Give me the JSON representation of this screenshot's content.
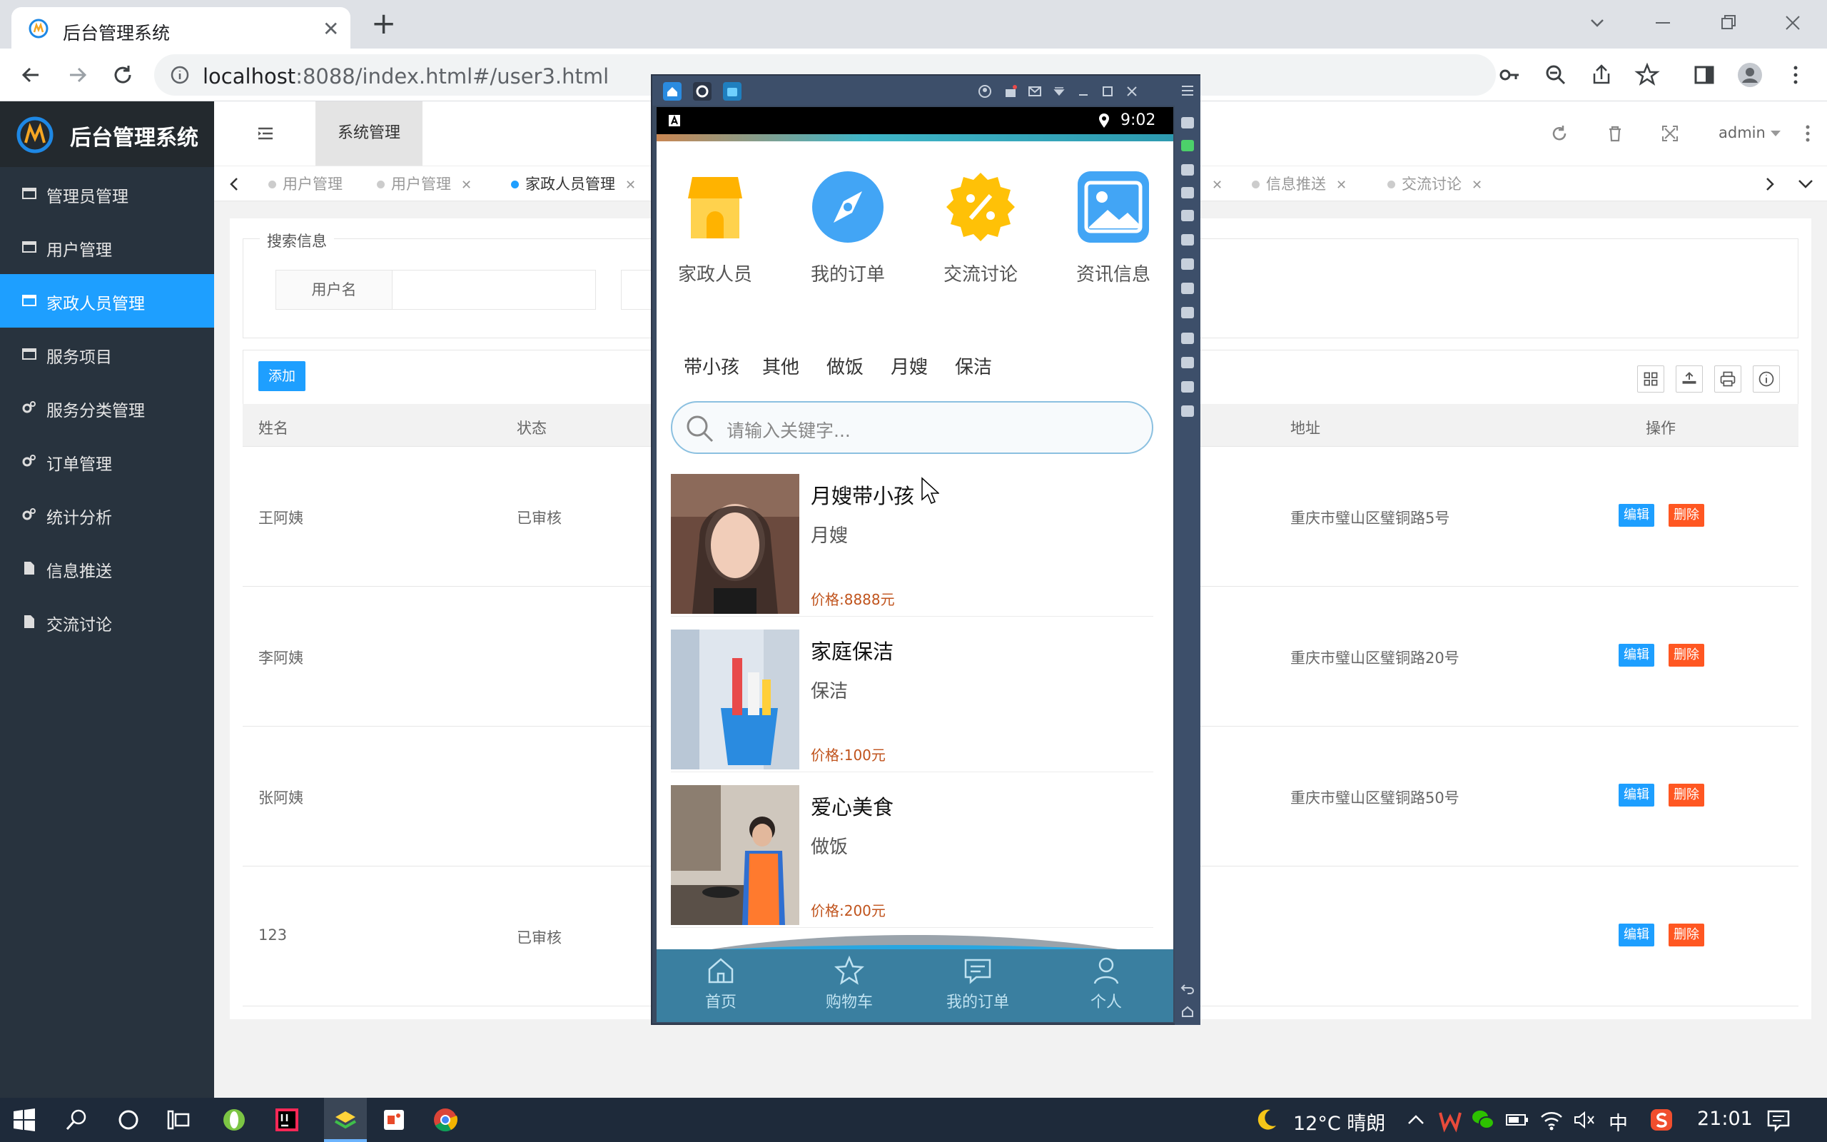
{
  "browser": {
    "tab_title": "后台管理系统",
    "url_host": "localhost",
    "url_rest": ":8088/index.html#/user3.html"
  },
  "sidebar": {
    "title": "后台管理系统",
    "items": [
      {
        "label": "管理员管理"
      },
      {
        "label": "用户管理"
      },
      {
        "label": "家政人员管理"
      },
      {
        "label": "服务项目"
      },
      {
        "label": "服务分类管理"
      },
      {
        "label": "订单管理"
      },
      {
        "label": "统计分析"
      },
      {
        "label": "信息推送"
      },
      {
        "label": "交流讨论"
      }
    ]
  },
  "header": {
    "section": "系统管理",
    "user": "admin"
  },
  "page_tabs": [
    {
      "label": "用户管理"
    },
    {
      "label": "用户管理"
    },
    {
      "label": "家政人员管理"
    },
    {
      "label": "信息推送"
    },
    {
      "label": "交流讨论"
    }
  ],
  "search": {
    "legend": "搜索信息",
    "username_label": "用户名"
  },
  "table": {
    "add_label": "添加",
    "headers": {
      "name": "姓名",
      "status": "状态",
      "address": "地址",
      "ops": "操作"
    },
    "edit_label": "编辑",
    "delete_label": "删除",
    "rows": [
      {
        "name": "王阿姨",
        "status": "已审核",
        "address": "重庆市璧山区璧铜路5号"
      },
      {
        "name": "李阿姨",
        "status": "",
        "address": "重庆市璧山区璧铜路20号"
      },
      {
        "name": "张阿姨",
        "status": "",
        "address": "重庆市璧山区璧铜路50号"
      },
      {
        "name": "123",
        "status": "已审核",
        "address": ""
      }
    ]
  },
  "emulator": {
    "time": "9:02",
    "categories": [
      {
        "label": "家政人员",
        "icon": "shop-icon"
      },
      {
        "label": "我的订单",
        "icon": "compass-icon"
      },
      {
        "label": "交流讨论",
        "icon": "discount-icon"
      },
      {
        "label": "资讯信息",
        "icon": "image-icon"
      }
    ],
    "filters": [
      "带小孩",
      "其他",
      "做饭",
      "月嫂",
      "保洁"
    ],
    "search_placeholder": "请输入关键字...",
    "cards": [
      {
        "title": "月嫂带小孩",
        "subtitle": "月嫂",
        "price": "价格:8888元"
      },
      {
        "title": "家庭保洁",
        "subtitle": "保洁",
        "price": "价格:100元"
      },
      {
        "title": "爱心美食",
        "subtitle": "做饭",
        "price": "价格:200元"
      }
    ],
    "nav": [
      {
        "label": "首页"
      },
      {
        "label": "购物车"
      },
      {
        "label": "我的订单"
      },
      {
        "label": "个人"
      }
    ]
  },
  "taskbar": {
    "weather": "12°C 晴朗",
    "ime": "中",
    "clock": "21:01"
  },
  "colors": {
    "accent": "#1e9fff",
    "danger": "#ff5722",
    "sidebar": "#28333e"
  }
}
